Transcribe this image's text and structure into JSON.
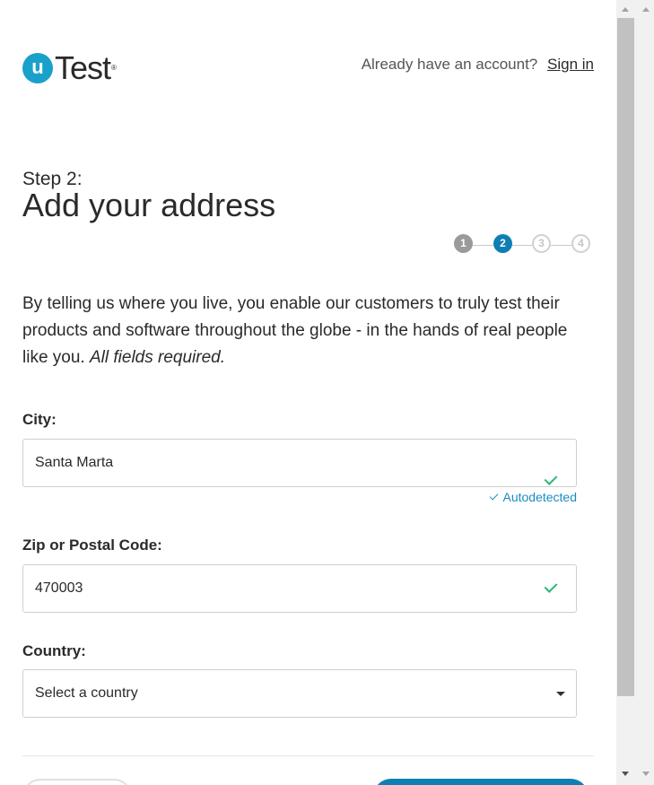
{
  "header": {
    "logo_mark": "u",
    "logo_text": "Test",
    "logo_reg": "®",
    "account_prompt": "Already have an account?",
    "sign_in_label": "Sign in"
  },
  "title": {
    "step_label": "Step 2:",
    "heading": "Add your address"
  },
  "stepper": {
    "steps": [
      {
        "number": "1",
        "state": "done"
      },
      {
        "number": "2",
        "state": "current"
      },
      {
        "number": "3",
        "state": "todo"
      },
      {
        "number": "4",
        "state": "todo"
      }
    ]
  },
  "intro": {
    "text": "By telling us where you live, you enable our customers to truly test their products and software throughout the globe - in the hands of real people like you.",
    "required_note": "All fields required."
  },
  "form": {
    "city": {
      "label": "City:",
      "value": "Santa Marta",
      "status": "Autodetected",
      "valid": true
    },
    "zip": {
      "label": "Zip or Postal Code:",
      "value": "470003",
      "valid": true
    },
    "country": {
      "label": "Country:",
      "value": "Select a country"
    }
  },
  "colors": {
    "accent": "#0f7fb3",
    "logo": "#1aa1c9",
    "success": "#2bb673",
    "autodetected": "#1a8cc0"
  },
  "icons": {
    "check": "check-icon",
    "dropdown": "chevron-down-icon"
  }
}
